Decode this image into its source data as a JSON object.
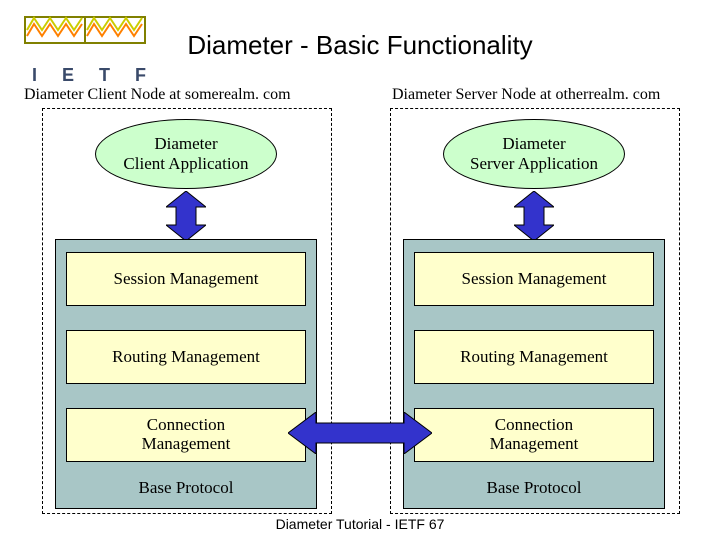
{
  "title": "Diameter - Basic Functionality",
  "logo_text": "I E T F",
  "left": {
    "header": "Diameter Client Node at somerealm. com",
    "app": "Diameter\nClient Application",
    "layers": [
      "Session Management",
      "Routing Management",
      "Connection\nManagement"
    ],
    "base": "Base Protocol"
  },
  "right": {
    "header": "Diameter Server Node at otherrealm. com",
    "app": "Diameter\nServer Application",
    "layers": [
      "Session Management",
      "Routing Management",
      "Connection\nManagement"
    ],
    "base": "Base Protocol"
  },
  "footer": "Diameter Tutorial - IETF 67",
  "colors": {
    "ellipse_fill": "#ccffcc",
    "stack_fill": "#a8c6c6",
    "layer_fill": "#ffffcc",
    "arrow_fill": "#3333cc"
  }
}
